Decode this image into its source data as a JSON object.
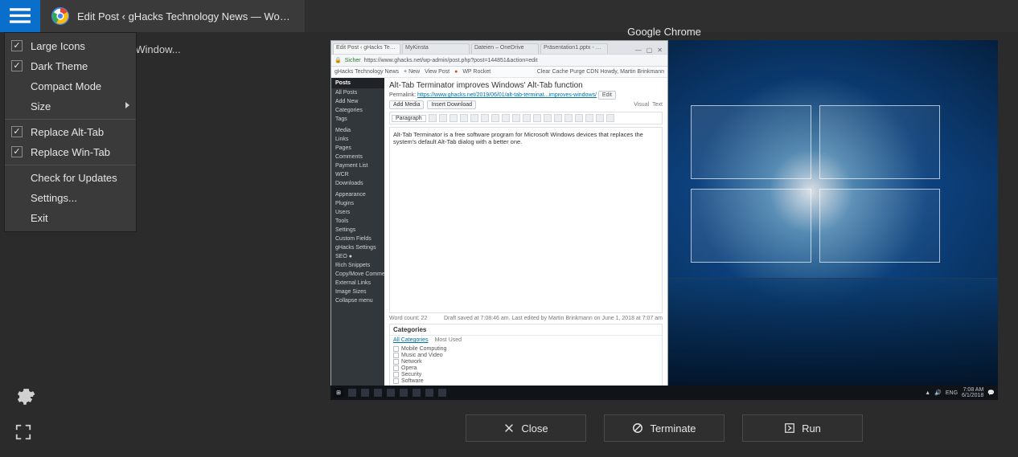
{
  "topbar": {
    "active_tab_title": "Edit Post ‹ gHacks Technology News — WordPr..."
  },
  "secondary_row_text": "rminator - Manage Multiple Window...",
  "menu": {
    "items": [
      {
        "label": "Large Icons",
        "checked": true,
        "submenu": false
      },
      {
        "label": "Dark Theme",
        "checked": true,
        "submenu": false
      },
      {
        "label": "Compact Mode",
        "checked": false,
        "nolabel_checkbox": true,
        "submenu": false
      },
      {
        "label": "Size",
        "checked": false,
        "nolabel_checkbox": true,
        "submenu": true
      }
    ],
    "items2": [
      {
        "label": "Replace Alt-Tab",
        "checked": true
      },
      {
        "label": "Replace Win-Tab",
        "checked": true
      }
    ],
    "items3": [
      {
        "label": "Check for Updates"
      },
      {
        "label": "Settings..."
      },
      {
        "label": "Exit"
      }
    ]
  },
  "preview": {
    "title": "Google Chrome",
    "browser_tabs": [
      "Edit Post ‹ gHacks Tech…",
      "MyKinsta",
      "Dateien – OneDrive",
      "Präsentation1.pptx - Mi…"
    ],
    "window_controls": {
      "min": "—",
      "max": "▢",
      "close": "✕"
    },
    "url_scheme": "Sicher",
    "url": "https://www.ghacks.net/wp-admin/post.php?post=144851&action=edit",
    "bookmarks_left": "gHacks Technology News",
    "bookmarks_new": "+ New",
    "bookmarks_view": "View Post",
    "bookmarks_rocket": "WP Rocket",
    "bookmarks_right": "Clear Cache   Purge CDN   Howdy, Martin Brinkmann",
    "wp_sidebar_header": "Posts",
    "wp_sidebar": [
      "All Posts",
      "Add New",
      "Categories",
      "Tags",
      "Media",
      "Links",
      "Pages",
      "Comments",
      "Payment List",
      "WCR",
      "Downloads",
      "Appearance",
      "Plugins",
      "Users",
      "Tools",
      "Settings",
      "Custom Fields",
      "gHacks Settings",
      "SEO ●",
      "Rich Snippets",
      "Copy/Move Comments",
      "External Links",
      "Image Sizes",
      "Collapse menu"
    ],
    "post_title": "Alt-Tab Terminator improves Windows' Alt-Tab function",
    "permalink_label": "Permalink:",
    "permalink_url": "https://www.ghacks.net/2019/06/01/alt-tab-terminat...improves-windows/",
    "permalink_edit": "Edit",
    "btn_add_media": "Add Media",
    "btn_insert_download": "Insert Download",
    "editor_tab_visual": "Visual",
    "editor_tab_text": "Text",
    "toolbar_select": "Paragraph",
    "body_text": "Alt-Tab Terminator is a free software program for Microsoft Windows devices that replaces the system's default Alt-Tab dialog with a better one.",
    "word_count_label": "Word count: 22",
    "draft_status": "Draft saved at 7:08:46 am. Last edited by Martin Brinkmann on June 1, 2018 at 7:07 am",
    "categories_header": "Categories",
    "cat_tab1": "All Categories",
    "cat_tab2": "Most Used",
    "categories": [
      "Mobile Computing",
      "Music and Video",
      "Network",
      "Opera",
      "Security",
      "Software"
    ],
    "tray_time": "7:08 AM",
    "tray_date": "6/1/2018",
    "tray_lang": "ENG"
  },
  "actions": {
    "close": "Close",
    "terminate": "Terminate",
    "run": "Run"
  }
}
